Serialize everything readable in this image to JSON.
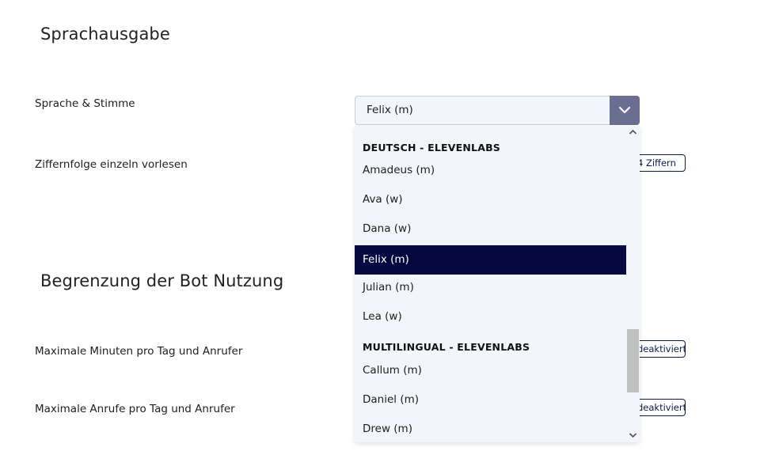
{
  "sections": {
    "speech_output_title": "Sprachausgabe",
    "bot_limit_title": "Begrenzung der Bot Nutzung"
  },
  "rows": {
    "voice_label": "Sprache & Stimme",
    "digits_label": "Ziffernfolge einzeln vorlesen",
    "digits_value": "4 Ziffern",
    "max_minutes_label": "Maximale Minuten pro Tag und Anrufer",
    "max_minutes_value": "deaktiviert",
    "max_calls_label": "Maximale Anrufe pro Tag und Anrufer",
    "max_calls_value": "deaktiviert"
  },
  "voice_select": {
    "selected": "Felix (m)",
    "groups": [
      {
        "header": "DEUTSCH - ELEVENLABS",
        "options": [
          "Amadeus (m)",
          "Ava (w)",
          "Dana (w)",
          "Felix (m)",
          "Julian (m)",
          "Lea (w)"
        ]
      },
      {
        "header": "MULTILINGUAL - ELEVENLABS",
        "options": [
          "Callum (m)",
          "Daniel (m)",
          "Drew (m)"
        ]
      }
    ]
  },
  "colors": {
    "selected_bg": "#05093f",
    "dropdown_bg": "#f2f5f9",
    "select_button": "#6a6f92",
    "pill_border": "#0b1a4a"
  },
  "icons": {
    "select_toggle": "chevron-down-icon",
    "scroll_up": "scroll-up-arrow-icon",
    "scroll_down": "scroll-down-arrow-icon"
  }
}
